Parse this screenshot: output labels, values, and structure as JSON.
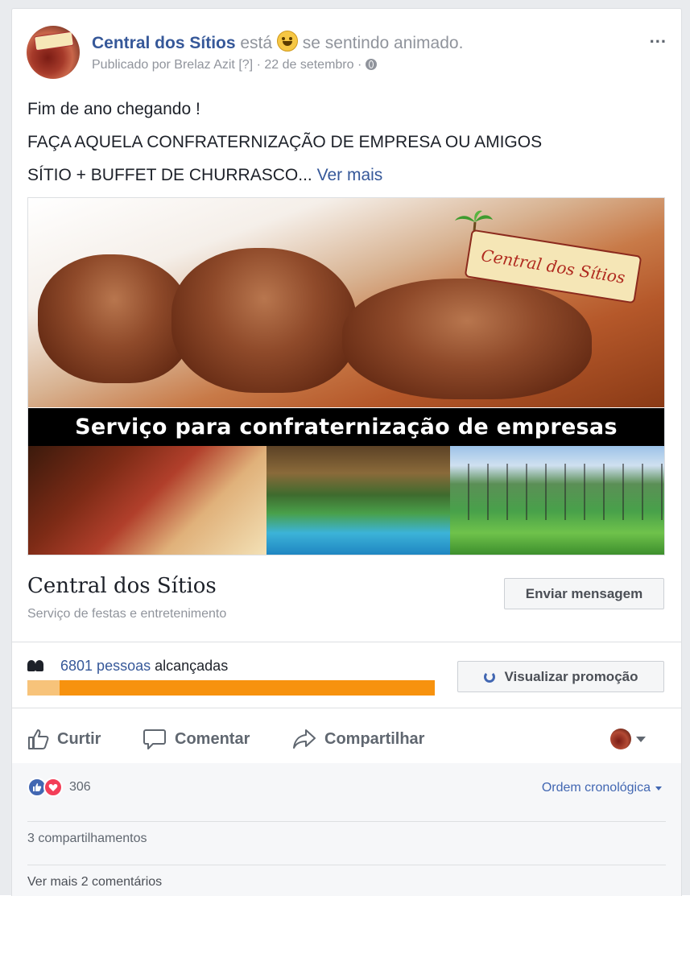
{
  "post": {
    "page_name": "Central dos Sítios",
    "feeling_prefix": "está",
    "feeling_text": "se sentindo animado.",
    "published_by": "Publicado por Brelaz Azit [?]",
    "date": "· 22 de setembro ·",
    "text_line1": "Fim de ano chegando !",
    "text_line2": "FAÇA AQUELA CONFRATERNIZAÇÃO DE EMPRESA OU AMIGOS",
    "text_line3": "SÍTIO + BUFFET DE CHURRASCO...",
    "see_more": "Ver mais",
    "more_icon": "..."
  },
  "image": {
    "banner_text": "Serviço para confraternização de empresas",
    "logo_text": "Central dos Sítios"
  },
  "page_card": {
    "title": "Central dos Sítios",
    "category": "Serviço de festas e entretenimento",
    "message_button": "Enviar mensagem"
  },
  "promotion": {
    "reach_number": "6801 pessoas",
    "reach_suffix": "alcançadas",
    "progress_fraction": 0.08,
    "view_button": "Visualizar promoção"
  },
  "actions": {
    "like": "Curtir",
    "comment": "Comentar",
    "share": "Compartilhar"
  },
  "feedback": {
    "reaction_count": "306",
    "order_label": "Ordem cronológica",
    "shares": "3 compartilhamentos",
    "more_comments": "Ver mais 2 comentários"
  },
  "colors": {
    "link": "#365899",
    "progress_fill": "#f7920e",
    "progress_track": "#f7c37a",
    "like": "#4267b2",
    "love": "#f33e58"
  }
}
